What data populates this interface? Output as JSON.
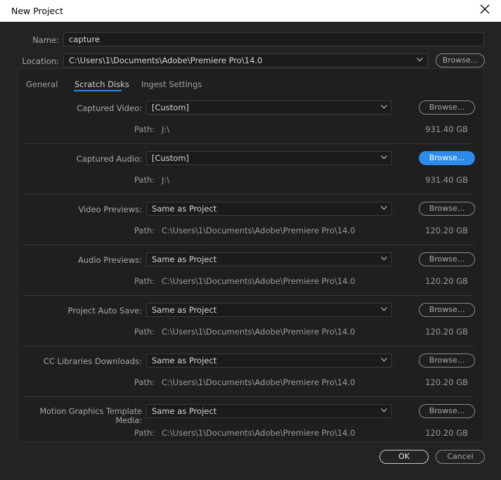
{
  "window": {
    "title": "New Project"
  },
  "header": {
    "name_label": "Name:",
    "name_value": "capture",
    "location_label": "Location:",
    "location_value": "C:\\Users\\1\\Documents\\Adobe\\Premiere Pro\\14.0",
    "browse_label": "Browse..."
  },
  "tabs": [
    {
      "label": "General"
    },
    {
      "label": "Scratch Disks",
      "active": true
    },
    {
      "label": "Ingest Settings"
    }
  ],
  "path_label": "Path:",
  "rows": [
    {
      "label": "Captured Video:",
      "value": "[Custom]",
      "path": "J:\\",
      "size": "931.40 GB",
      "browse": "Browse..."
    },
    {
      "label": "Captured Audio:",
      "value": "[Custom]",
      "path": "J:\\",
      "size": "931.40 GB",
      "browse": "Browse..."
    },
    {
      "label": "Video Previews:",
      "value": "Same as Project",
      "path": "C:\\Users\\1\\Documents\\Adobe\\Premiere Pro\\14.0",
      "size": "120.20 GB",
      "browse": "Browse..."
    },
    {
      "label": "Audio Previews:",
      "value": "Same as Project",
      "path": "C:\\Users\\1\\Documents\\Adobe\\Premiere Pro\\14.0",
      "size": "120.20 GB",
      "browse": "Browse..."
    },
    {
      "label": "Project Auto Save:",
      "value": "Same as Project",
      "path": "C:\\Users\\1\\Documents\\Adobe\\Premiere Pro\\14.0",
      "size": "120.20 GB",
      "browse": "Browse..."
    },
    {
      "label": "CC Libraries Downloads:",
      "value": "Same as Project",
      "path": "C:\\Users\\1\\Documents\\Adobe\\Premiere Pro\\14.0",
      "size": "120.20 GB",
      "browse": "Browse..."
    },
    {
      "label": "Motion Graphics Template Media:",
      "value": "Same as Project",
      "path": "C:\\Users\\1\\Documents\\Adobe\\Premiere Pro\\14.0",
      "size": "120.20 GB",
      "browse": "Browse..."
    }
  ],
  "footer": {
    "ok_label": "OK",
    "cancel_label": "Cancel"
  },
  "colors": {
    "accent": "#2d8ceb",
    "background": "#232323",
    "panel": "#1f1f1f"
  }
}
